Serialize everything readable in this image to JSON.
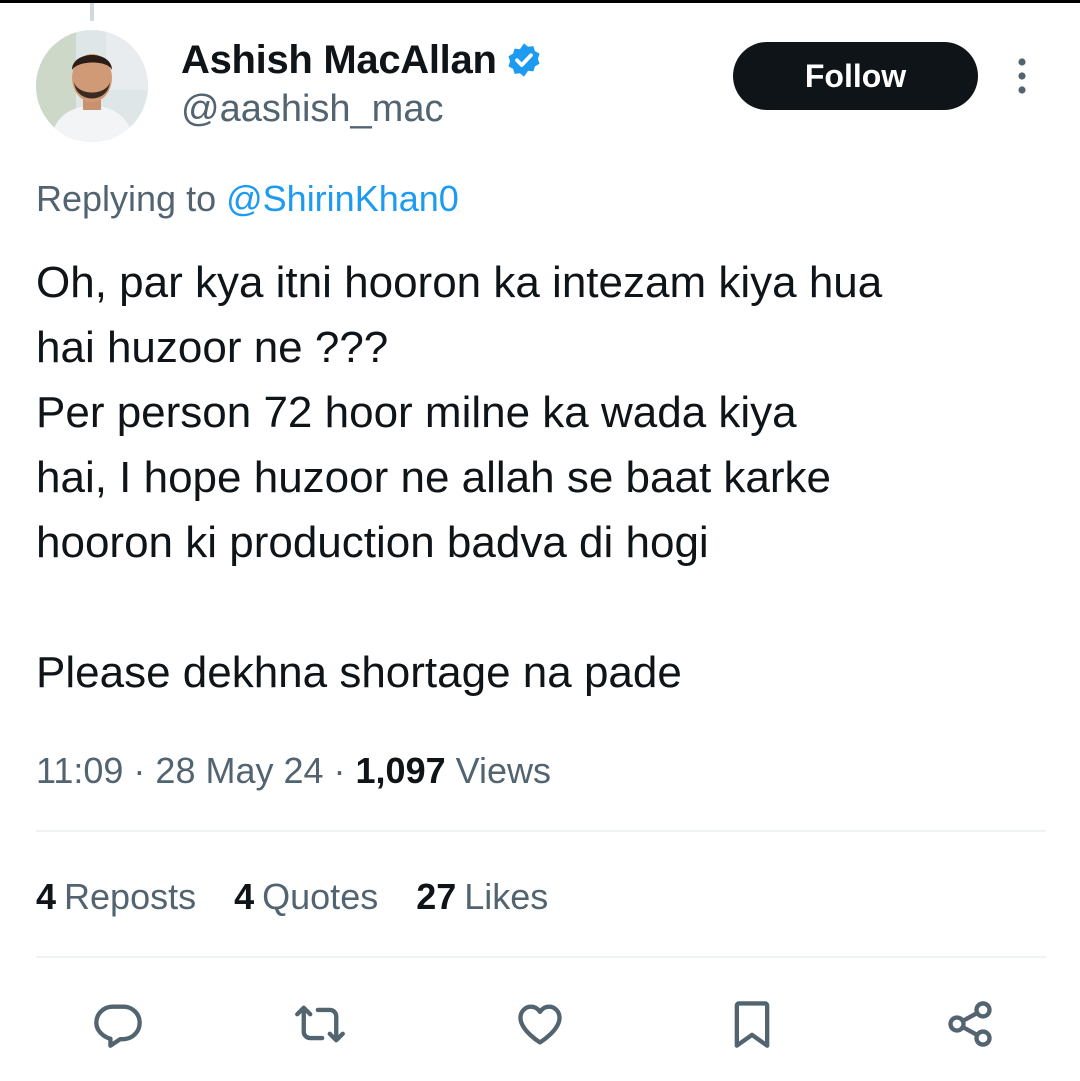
{
  "author": {
    "name": "Ashish MacAllan",
    "handle": "@aashish_mac",
    "verified": true
  },
  "follow_label": "Follow",
  "reply_context": {
    "prefix": "Replying to ",
    "mention": "@ShirinKhan0"
  },
  "tweet": {
    "lines": [
      "Oh, par kya itni hooron ka intezam kiya hua",
      "hai huzoor ne ???",
      "Per person 72 hoor milne ka wada kiya",
      "hai, I hope huzoor ne allah se baat karke",
      "hooron ki production badva di hogi",
      "",
      "Please dekhna shortage na pade"
    ]
  },
  "meta": {
    "time": "11:09",
    "separator": " · ",
    "date": "28 May 24",
    "views_count": "1,097",
    "views_label": " Views"
  },
  "stats": {
    "reposts_count": "4",
    "reposts_label": "Reposts",
    "quotes_count": "4",
    "quotes_label": "Quotes",
    "likes_count": "27",
    "likes_label": "Likes"
  },
  "actions": [
    "reply-icon",
    "repost-icon",
    "like-icon",
    "bookmark-icon",
    "share-icon"
  ],
  "colors": {
    "text": "#0f1419",
    "secondary": "#536471",
    "link": "#1d9bf0",
    "verified": "#1d9bf0",
    "divider": "#eff3f4"
  }
}
